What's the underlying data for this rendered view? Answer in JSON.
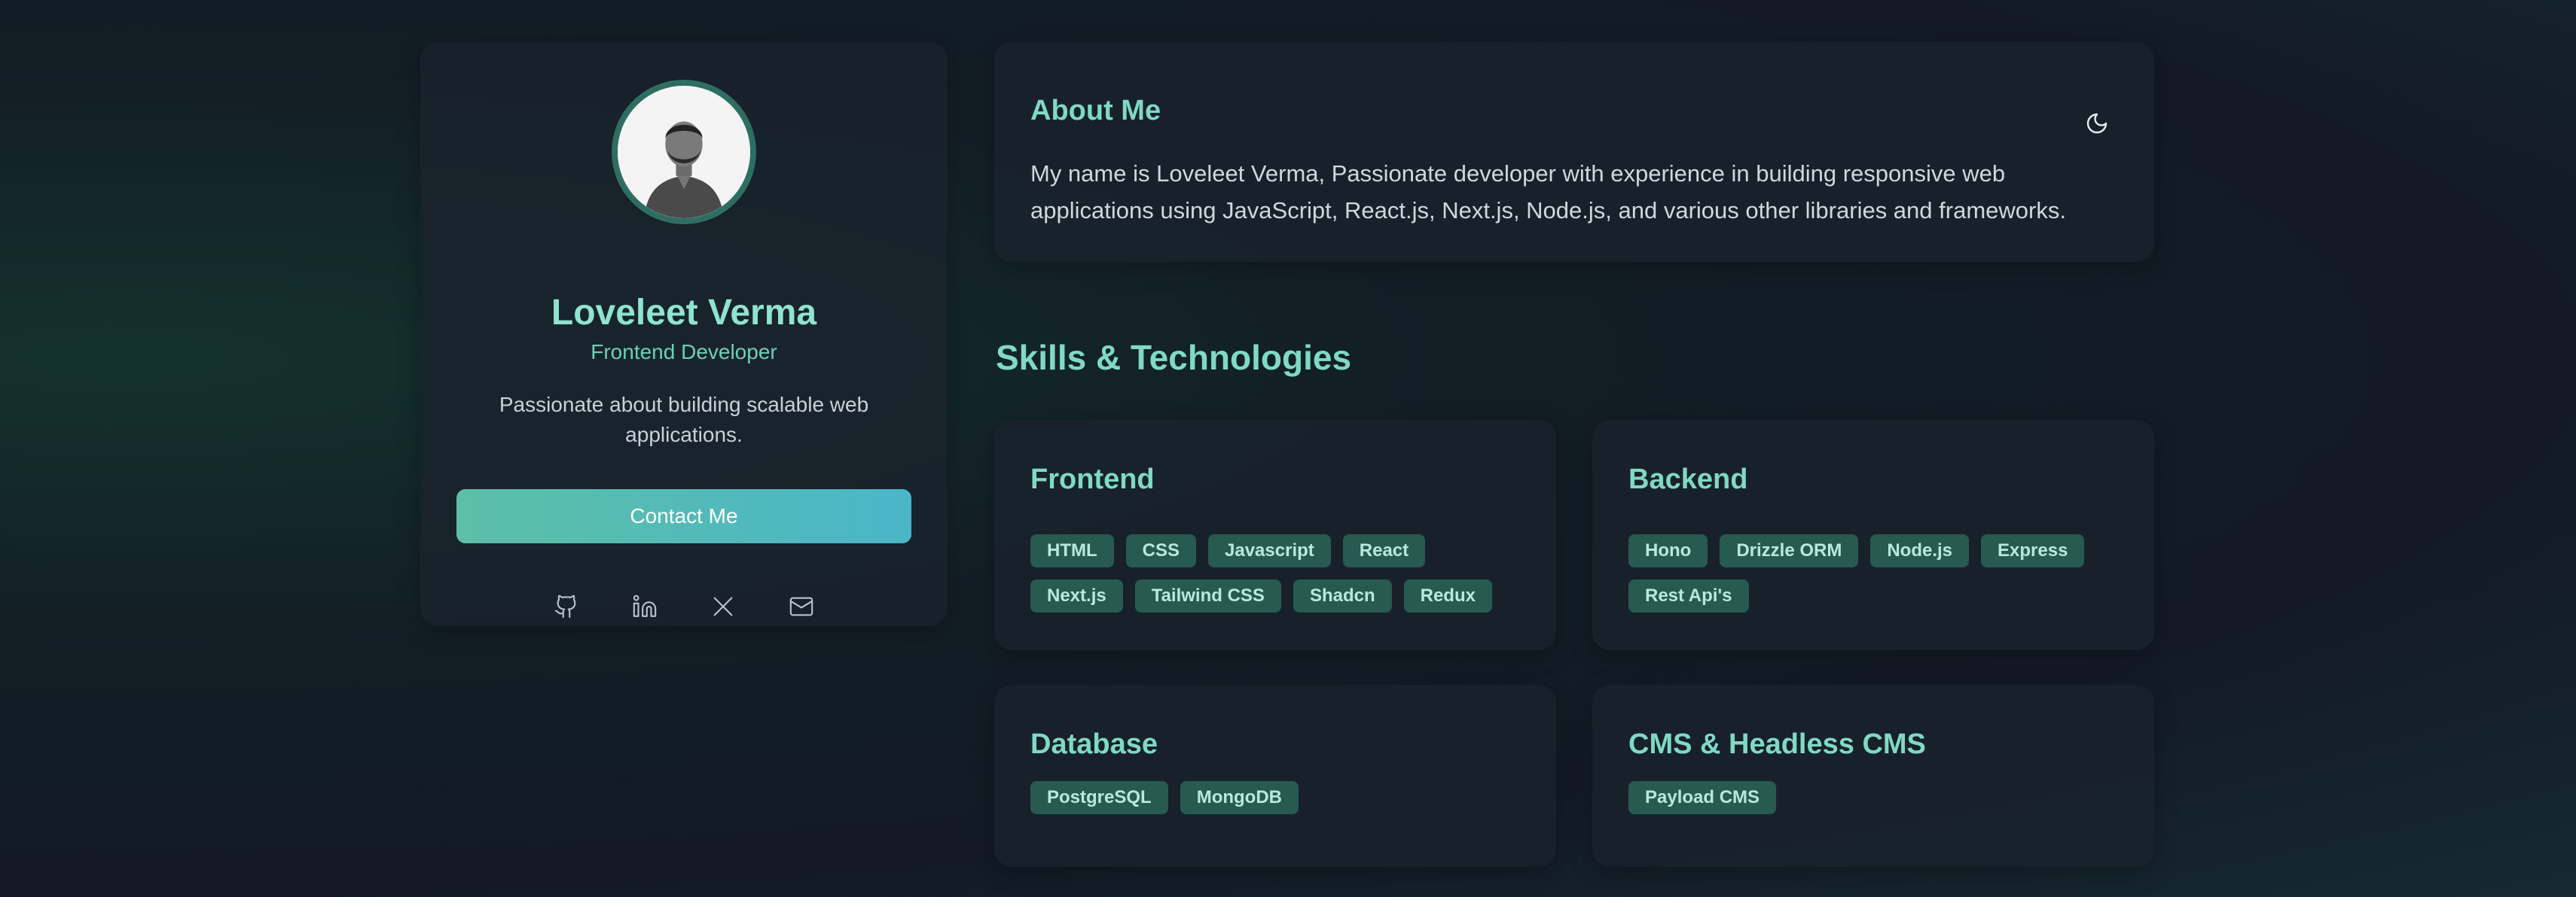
{
  "profile": {
    "name": "Loveleet Verma",
    "role": "Frontend Developer",
    "tagline": "Passionate about building scalable web applications.",
    "contact_label": "Contact Me",
    "socials": [
      "github-icon",
      "linkedin-icon",
      "x-icon",
      "mail-icon"
    ]
  },
  "about": {
    "title": "About Me",
    "text": "My name is Loveleet Verma, Passionate developer with experience in building responsive web applications using JavaScript, React.js, Next.js, Node.js, and various other libraries and frameworks.",
    "toggle_icon": "moon-icon"
  },
  "skills": {
    "title": "Skills & Technologies",
    "groups": [
      {
        "title": "Frontend",
        "tags": [
          "HTML",
          "CSS",
          "Javascript",
          "React",
          "Next.js",
          "Tailwind CSS",
          "Shadcn",
          "Redux"
        ]
      },
      {
        "title": "Backend",
        "tags": [
          "Hono",
          "Drizzle ORM",
          "Node.js",
          "Express",
          "Rest Api's"
        ]
      },
      {
        "title": "Database",
        "tags": [
          "PostgreSQL",
          "MongoDB"
        ]
      },
      {
        "title": "CMS & Headless CMS",
        "tags": [
          "Payload CMS"
        ]
      }
    ]
  },
  "colors": {
    "accent": "#7fd9c4",
    "tag_bg": "#275a51",
    "button_gradient_start": "#5dbfa6",
    "button_gradient_end": "#4ab6c9"
  }
}
